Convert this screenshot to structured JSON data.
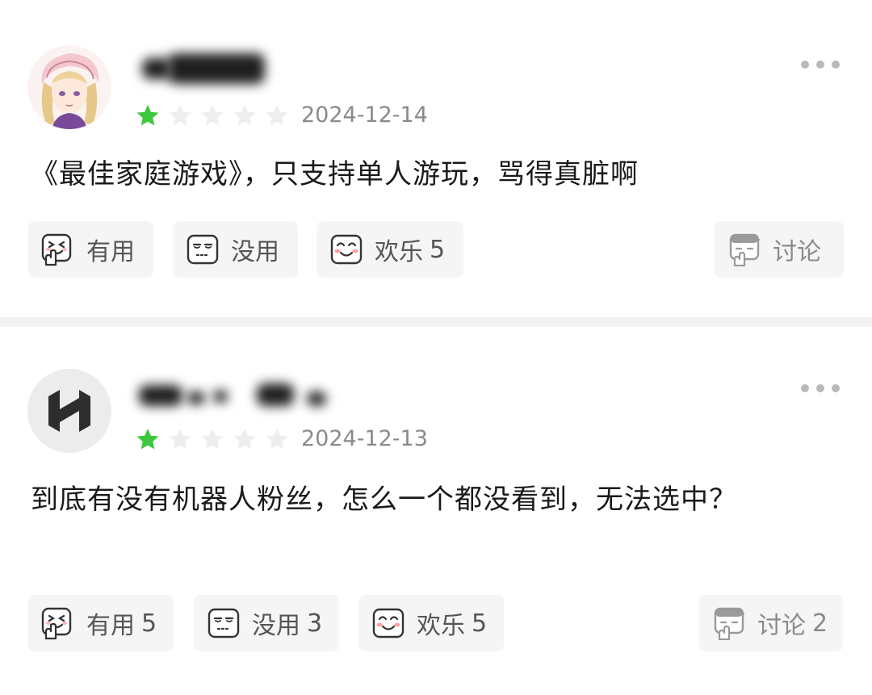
{
  "reviews": [
    {
      "date": "2024-12-14",
      "rating": 1,
      "content": "《最佳家庭游戏》，只支持单人游玩，骂得真脏啊",
      "actions": {
        "useful": {
          "label": "有用",
          "count": ""
        },
        "useless": {
          "label": "没用",
          "count": ""
        },
        "fun": {
          "label": "欢乐",
          "count": "5"
        },
        "discuss": {
          "label": "讨论",
          "count": ""
        }
      }
    },
    {
      "date": "2024-12-13",
      "rating": 1,
      "content": "到底有没有机器人粉丝，怎么一个都没看到，无法选中？",
      "actions": {
        "useful": {
          "label": "有用",
          "count": "5"
        },
        "useless": {
          "label": "没用",
          "count": "3"
        },
        "fun": {
          "label": "欢乐",
          "count": "5"
        },
        "discuss": {
          "label": "讨论",
          "count": "2"
        }
      }
    }
  ],
  "colors": {
    "star_filled": "#3cc83c",
    "star_empty": "#eeeeee",
    "button_bg": "#f5f5f5",
    "divider": "#f2f2f2"
  }
}
